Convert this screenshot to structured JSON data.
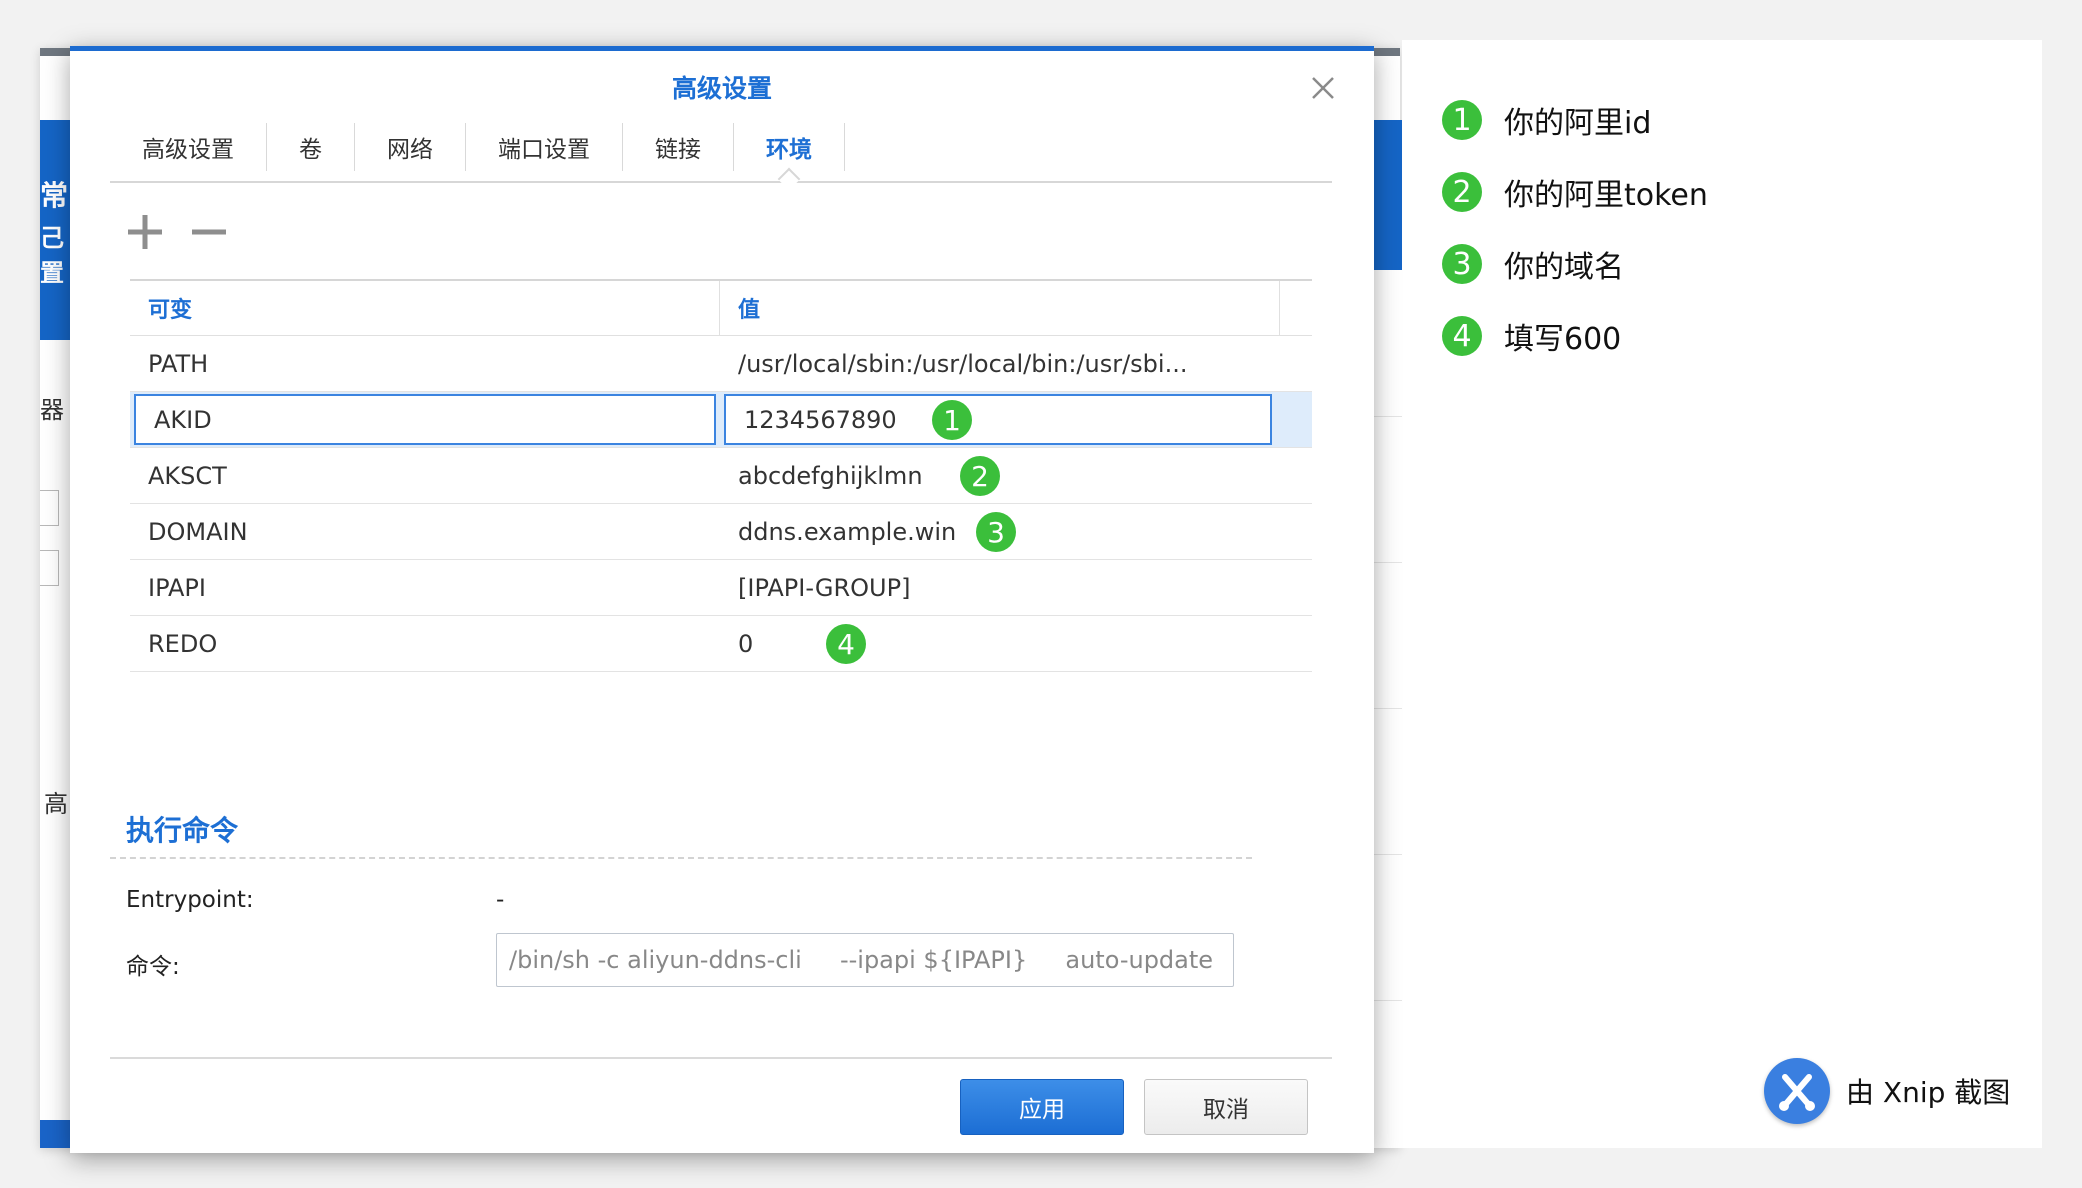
{
  "dialog": {
    "title": "高级设置",
    "tabs": [
      {
        "label": "高级设置"
      },
      {
        "label": "卷"
      },
      {
        "label": "网络"
      },
      {
        "label": "端口设置"
      },
      {
        "label": "链接"
      },
      {
        "label": "环境"
      }
    ],
    "active_tab": "环境",
    "table": {
      "headers": {
        "variable": "可变",
        "value": "值"
      },
      "rows": [
        {
          "name": "PATH",
          "value": "/usr/local/sbin:/usr/local/bin:/usr/sbi..."
        },
        {
          "name": "AKID",
          "value": "1234567890",
          "marker": "1"
        },
        {
          "name": "AKSCT",
          "value": "abcdefghijklmn",
          "marker": "2"
        },
        {
          "name": "DOMAIN",
          "value": "ddns.example.win",
          "marker": "3"
        },
        {
          "name": "IPAPI",
          "value": "[IPAPI-GROUP]"
        },
        {
          "name": "REDO",
          "value": "0",
          "marker": "4"
        }
      ]
    },
    "exec": {
      "title": "执行命令",
      "entrypoint_label": "Entrypoint:",
      "entrypoint_value": "-",
      "command_label": "命令:",
      "command_value": "/bin/sh -c aliyun-ddns-cli     --ipapi ${IPAPI}     auto-update --domain ${DOMAIN} --redo ${REDO}"
    },
    "buttons": {
      "apply": "应用",
      "cancel": "取消"
    }
  },
  "annotations": [
    {
      "num": "1",
      "text": "你的阿里id"
    },
    {
      "num": "2",
      "text": "你的阿里token"
    },
    {
      "num": "3",
      "text": "你的域名"
    },
    {
      "num": "4",
      "text": "填写600"
    }
  ],
  "watermark": {
    "text": "由 Xnip 截图"
  },
  "background_fragments": {
    "blue_top": "常",
    "blue_bottom": "己置",
    "label_a": "器",
    "label_b": "高"
  },
  "colors": {
    "accent": "#1d6fd4",
    "marker_green": "#3bbf3b",
    "selection_border": "#3b84e0",
    "apply_button": "#1c6ed4"
  }
}
